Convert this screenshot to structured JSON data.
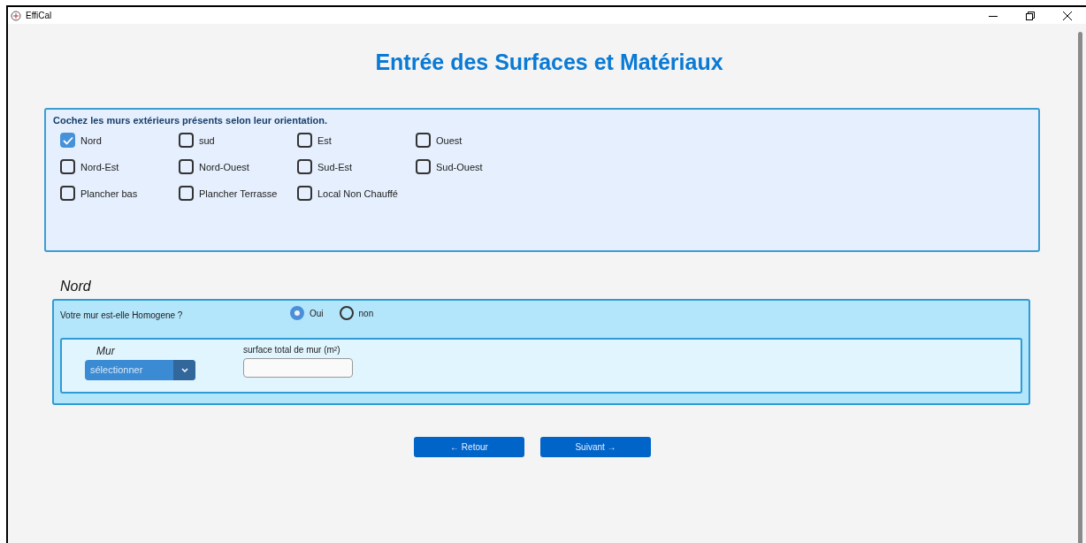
{
  "window": {
    "title": "EffiCal"
  },
  "heading": "Entrée des Surfaces et Matériaux",
  "walls_panel": {
    "prompt": "Cochez les murs extérieurs présents selon leur orientation.",
    "options": [
      {
        "label": "Nord",
        "checked": true
      },
      {
        "label": "sud",
        "checked": false
      },
      {
        "label": "Est",
        "checked": false
      },
      {
        "label": "Ouest",
        "checked": false
      },
      {
        "label": "Nord-Est",
        "checked": false
      },
      {
        "label": "Nord-Ouest",
        "checked": false
      },
      {
        "label": "Sud-Est",
        "checked": false
      },
      {
        "label": "Sud-Ouest",
        "checked": false
      },
      {
        "label": "Plancher bas",
        "checked": false
      },
      {
        "label": "Plancher Terrasse",
        "checked": false
      },
      {
        "label": "Local Non Chauffé",
        "checked": false
      }
    ]
  },
  "wall_section": {
    "title": "Nord",
    "question": "Votre mur est-elle Homogene ?",
    "radios": [
      {
        "label": "Oui",
        "selected": true
      },
      {
        "label": "non",
        "selected": false
      }
    ],
    "wall_select": {
      "label": "Mur",
      "placeholder": "sélectionner"
    },
    "surface_field": {
      "label": "surface total de mur (m²)"
    }
  },
  "buttons": [
    {
      "label": "← Retour"
    },
    {
      "label": "Suivant →"
    }
  ]
}
